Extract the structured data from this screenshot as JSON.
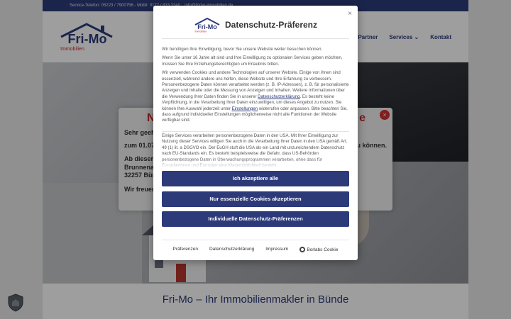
{
  "topbar": {
    "phone": "Service-Telefon: 05223 / 7900756 - Mobil: 0177 / 833 3340",
    "email": "info@frimo-immobilien.de"
  },
  "site": {
    "logo_text": "Fri-Mo",
    "logo_sub": "Immobilien",
    "nav": [
      "Partner",
      "Services",
      "Kontakt"
    ],
    "bottom_title": "Fri-Mo – Ihr Immobilienmakler in Bünde"
  },
  "notice": {
    "title_left": "N",
    "title_right": "e",
    "close": "×",
    "line1": "Sehr geehr",
    "line2": "zum 01.07.",
    "line2_right": "zu können.",
    "line3": "Ab diesem",
    "line4": "Brunnenal",
    "line5": "32257 Bün",
    "line6": "Wir freuen"
  },
  "modal": {
    "close": "×",
    "title": "Datenschutz-Präferenz",
    "intro": "Wir benötigen Ihre Einwilligung, bevor Sie unsere Website weiter besuchen können.",
    "p2": "Wenn Sie unter 16 Jahre alt sind und Ihre Einwilligung zu optionalen Services geben möchten, müssen Sie Ihre Erziehungsberechtigten um Erlaubnis bitten.",
    "p3a": "Wir verwenden Cookies und andere Technologien auf unserer Website. Einige von ihnen sind essenziell, während andere uns helfen, diese Website und Ihre Erfahrung zu verbessern. Personenbezogene Daten können verarbeitet werden (z. B. IP-Adressen), z. B. für personalisierte Anzeigen und Inhalte oder die Messung von Anzeigen und Inhalten. Weitere Informationen über die Verwendung Ihrer Daten finden Sie in unserer ",
    "p3_link1": "Datenschutzerklärung",
    "p3b": ". Es besteht keine Verpflichtung, in die Verarbeitung Ihrer Daten einzuwilligen, um dieses Angebot zu nutzen. Sie können Ihre Auswahl jederzeit unter ",
    "p3_link2": "Einstellungen",
    "p3c": " widerrufen oder anpassen. Bitte beachten Sie, dass aufgrund individueller Einstellungen möglicherweise nicht alle Funktionen der Website verfügbar sind.",
    "p4": "Einige Services verarbeiten personenbezogene Daten in den USA. Mit Ihrer Einwilligung zur Nutzung dieser Services willigen Sie auch in die Verarbeitung Ihrer Daten in den USA gemäß Art. 49 (1) lit. a DSGVO ein. Der EuGH stuft die USA als ein Land mit unzureichendem Datenschutz nach EU-Standards ein. Es besteht beispielsweise die Gefahr, dass US-Behörden personenbezogene Daten in Überwachungsprogrammen verarbeiten, ohne dass für Europäerinnen und Europäer eine Klagemöglichkeit besteht.",
    "btn_accept_all": "Ich akzeptiere alle",
    "btn_essential": "Nur essenzielle Cookies akzeptieren",
    "btn_individual": "Individuelle Datenschutz-Präferenzen",
    "footer": [
      "Präferenzen",
      "Datenschutzerklärung",
      "Impressum"
    ],
    "borlabs": "Borlabs Cookie"
  },
  "colors": {
    "brand": "#2d3a7a",
    "accent_red": "#c02b2b"
  }
}
